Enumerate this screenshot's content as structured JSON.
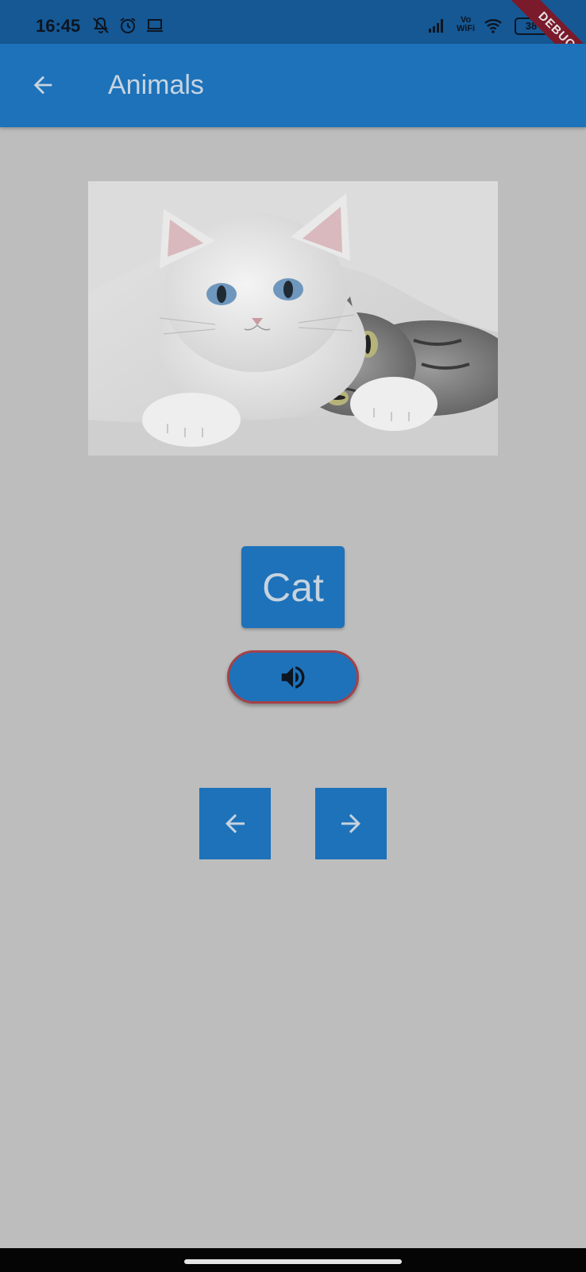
{
  "status_bar": {
    "time": "16:45",
    "icons": [
      "bell-off-icon",
      "alarm-icon",
      "laptop-icon",
      "signal-icon",
      "vowifi-icon",
      "wifi-icon",
      "battery-icon"
    ],
    "vowifi_top": "Vo",
    "vowifi_bottom": "WiFi",
    "battery_level": "38",
    "debug_label": "DEBUG"
  },
  "app_bar": {
    "title": "Animals",
    "back_icon": "arrow-back-icon"
  },
  "content": {
    "image_subject": "white kitten hugging a grey tabby cat",
    "word": "Cat",
    "speak_icon": "volume-up-icon",
    "prev_icon": "arrow-back-icon",
    "next_icon": "arrow-forward-icon"
  },
  "colors": {
    "primary": "#1d72ba",
    "status_bar": "#155894",
    "background": "#bdbdbd",
    "speak_border": "#a2424a",
    "debug_banner": "#7a1a2b"
  }
}
